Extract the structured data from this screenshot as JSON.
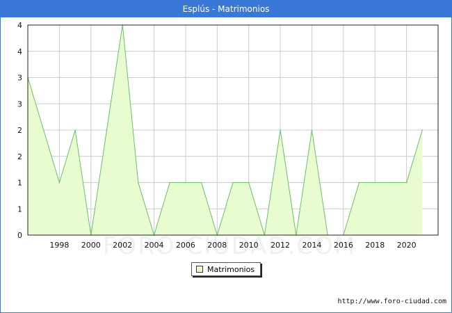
{
  "title": "Esplús - Matrimonios",
  "footer_url": "http://www.foro-ciudad.com",
  "watermark": "FORO-CIUDAD.COM",
  "colors": {
    "title_bg": "#3a78d8",
    "fill": "#e8fcd0",
    "line": "#6cbf6c",
    "grid": "#cccccc"
  },
  "chart_data": {
    "type": "area",
    "title": "Esplús - Matrimonios",
    "x": [
      1996,
      1997,
      1998,
      1999,
      2000,
      2001,
      2002,
      2003,
      2004,
      2005,
      2006,
      2007,
      2008,
      2009,
      2010,
      2011,
      2012,
      2013,
      2014,
      2015,
      2016,
      2017,
      2018,
      2019,
      2020,
      2021
    ],
    "series": [
      {
        "name": "Matrimonios",
        "values": [
          3,
          2,
          1,
          2,
          0,
          2,
          4,
          1,
          0,
          1,
          1,
          1,
          0,
          1,
          1,
          0,
          2,
          0,
          2,
          0,
          0,
          1,
          1,
          1,
          1,
          2
        ]
      }
    ],
    "x_ticks": [
      "1998",
      "2000",
      "2002",
      "2004",
      "2006",
      "2008",
      "2010",
      "2012",
      "2014",
      "2016",
      "2018",
      "2020"
    ],
    "y_tick_labels": [
      "0",
      "1",
      "1",
      "2",
      "2",
      "3",
      "3",
      "4",
      "4"
    ],
    "xlim": [
      1996,
      2022
    ],
    "ylim": [
      0,
      4
    ],
    "grid": true,
    "legend_position": "bottom-center"
  }
}
